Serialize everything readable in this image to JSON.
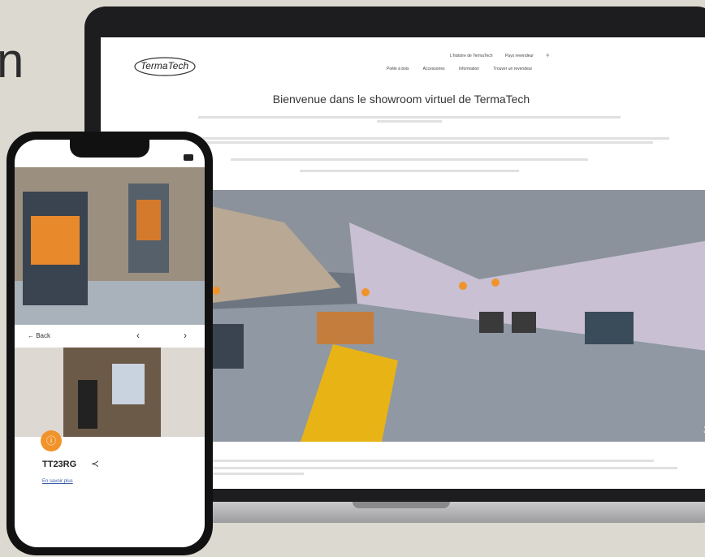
{
  "corner_text": "n",
  "site": {
    "logo": "TermaTech",
    "topnav": [
      "L'histoire de TermaTech",
      "Pays revendeur"
    ],
    "mainnav": [
      "Poêle à bois",
      "Accessoires",
      "Information",
      "Trouver un revendeur"
    ],
    "title": "Bienvenue dans le showroom virtuel de TermaTech"
  },
  "phone": {
    "back_label": "← Back",
    "prev_label": "‹",
    "next_label": "›",
    "model": "TT23RG",
    "share_icon": "share-icon",
    "link": "En savoir plus"
  },
  "colors": {
    "accent": "#f0932b",
    "rug": "#f2b705"
  }
}
